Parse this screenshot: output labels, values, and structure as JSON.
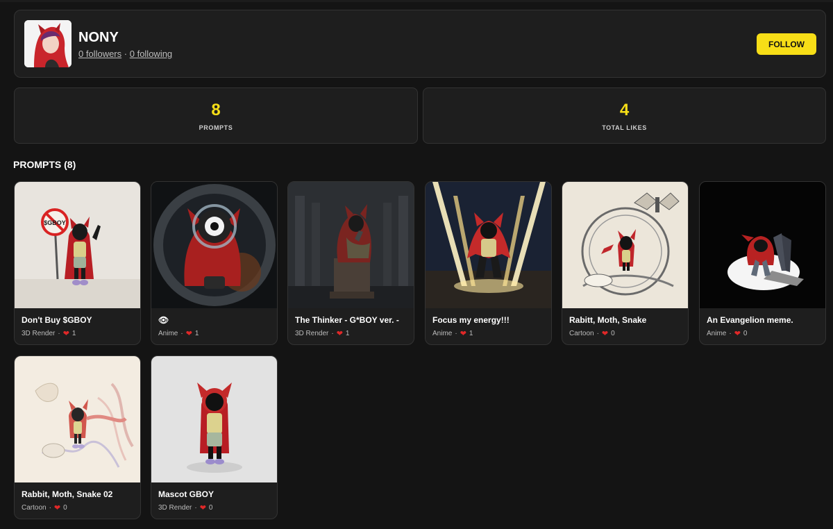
{
  "profile": {
    "name": "NONY",
    "followers_label": "0 followers",
    "separator": "·",
    "following_label": "0 following",
    "follow_button": "FOLLOW"
  },
  "stats": [
    {
      "value": "8",
      "label": "PROMPTS"
    },
    {
      "value": "4",
      "label": "TOTAL LIKES"
    }
  ],
  "section": {
    "title": "PROMPTS (8)"
  },
  "cards": [
    {
      "title": "Don't Buy $GBOY",
      "category": "3D Render",
      "likes": "1"
    },
    {
      "title": "👁",
      "category": "Anime",
      "likes": "1"
    },
    {
      "title": "The Thinker - G*BOY ver. -",
      "category": "3D Render",
      "likes": "1"
    },
    {
      "title": "Focus my energy!!!",
      "category": "Anime",
      "likes": "1"
    },
    {
      "title": "Rabitt, Moth, Snake",
      "category": "Cartoon",
      "likes": "0"
    },
    {
      "title": "An Evangelion meme.",
      "category": "Anime",
      "likes": "0"
    },
    {
      "title": "Rabbit, Moth, Snake 02",
      "category": "Cartoon",
      "likes": "0"
    },
    {
      "title": "Mascot GBOY",
      "category": "3D Render",
      "likes": "0"
    }
  ],
  "thumb_text": {
    "sign": "$GBOY"
  },
  "meta_separator": "·",
  "colors": {
    "accent": "#f7de17",
    "heart": "#e02828",
    "background": "#141414",
    "card": "#1e1e1e"
  }
}
